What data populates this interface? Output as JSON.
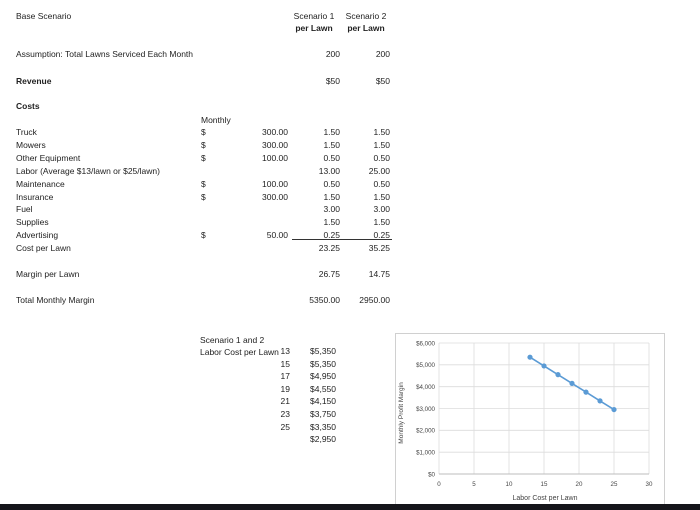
{
  "title": "Base Scenario",
  "headers": {
    "s1_line1": "Scenario 1",
    "s1_line2": "per Lawn",
    "s2_line1": "Scenario 2",
    "s2_line2": "per Lawn"
  },
  "assumption": {
    "label": "Assumption: Total Lawns Serviced Each Month",
    "s1": "200",
    "s2": "200"
  },
  "revenue": {
    "label": "Revenue",
    "s1": "$50",
    "s2": "$50"
  },
  "costs": {
    "label": "Costs",
    "monthly_header": "Monthly"
  },
  "cost_rows": [
    {
      "label": "Truck",
      "dollar": "$",
      "monthly": "300.00",
      "s1": "1.50",
      "s2": "1.50"
    },
    {
      "label": "Mowers",
      "dollar": "$",
      "monthly": "300.00",
      "s1": "1.50",
      "s2": "1.50"
    },
    {
      "label": "Other Equipment",
      "dollar": "$",
      "monthly": "100.00",
      "s1": "0.50",
      "s2": "0.50"
    },
    {
      "label": "Labor (Average $13/lawn or $25/lawn)",
      "dollar": "",
      "monthly": "",
      "s1": "13.00",
      "s2": "25.00"
    },
    {
      "label": "Maintenance",
      "dollar": "$",
      "monthly": "100.00",
      "s1": "0.50",
      "s2": "0.50"
    },
    {
      "label": "Insurance",
      "dollar": "$",
      "monthly": "300.00",
      "s1": "1.50",
      "s2": "1.50"
    },
    {
      "label": "Fuel",
      "dollar": "",
      "monthly": "",
      "s1": "3.00",
      "s2": "3.00"
    },
    {
      "label": "Supplies",
      "dollar": "",
      "monthly": "",
      "s1": "1.50",
      "s2": "1.50"
    },
    {
      "label": "Advertising",
      "dollar": "$",
      "monthly": "50.00",
      "s1": "0.25",
      "s2": "0.25"
    },
    {
      "label": "Cost per Lawn",
      "dollar": "",
      "monthly": "",
      "s1": "23.25",
      "s2": "35.25"
    }
  ],
  "margin": {
    "label": "Margin per Lawn",
    "s1": "26.75",
    "s2": "14.75"
  },
  "total": {
    "label": "Total Monthly Margin",
    "s1": "5350.00",
    "s2": "2950.00"
  },
  "labor_table": {
    "header_line1": "Scenario 1 and 2",
    "header_line2": "Labor Cost per Lawn",
    "rows": [
      {
        "cost": "13",
        "margin": "$5,350"
      },
      {
        "cost": "15",
        "margin": "$5,350"
      },
      {
        "cost": "17",
        "margin": "$4,950"
      },
      {
        "cost": "19",
        "margin": "$4,550"
      },
      {
        "cost": "21",
        "margin": "$4,150"
      },
      {
        "cost": "23",
        "margin": "$3,750"
      },
      {
        "cost": "25",
        "margin": "$3,350"
      },
      {
        "cost": "",
        "margin": "$2,950"
      }
    ]
  },
  "chart_data": {
    "type": "line",
    "xlabel": "Labor Cost per Lawn",
    "ylabel": "Monthly Profit Margin",
    "xlim": [
      0,
      30
    ],
    "ylim": [
      0,
      6000
    ],
    "x_ticks": [
      "0",
      "5",
      "10",
      "15",
      "20",
      "25",
      "30"
    ],
    "y_ticks": [
      "$0",
      "$1,000",
      "$2,000",
      "$3,000",
      "$4,000",
      "$5,000",
      "$6,000"
    ],
    "grid": true,
    "color": "#5b9bd5",
    "points": [
      {
        "x": 13,
        "y": 5350
      },
      {
        "x": 15,
        "y": 4950
      },
      {
        "x": 17,
        "y": 4550
      },
      {
        "x": 19,
        "y": 4150
      },
      {
        "x": 21,
        "y": 3750
      },
      {
        "x": 23,
        "y": 3350
      },
      {
        "x": 25,
        "y": 2950
      }
    ]
  }
}
